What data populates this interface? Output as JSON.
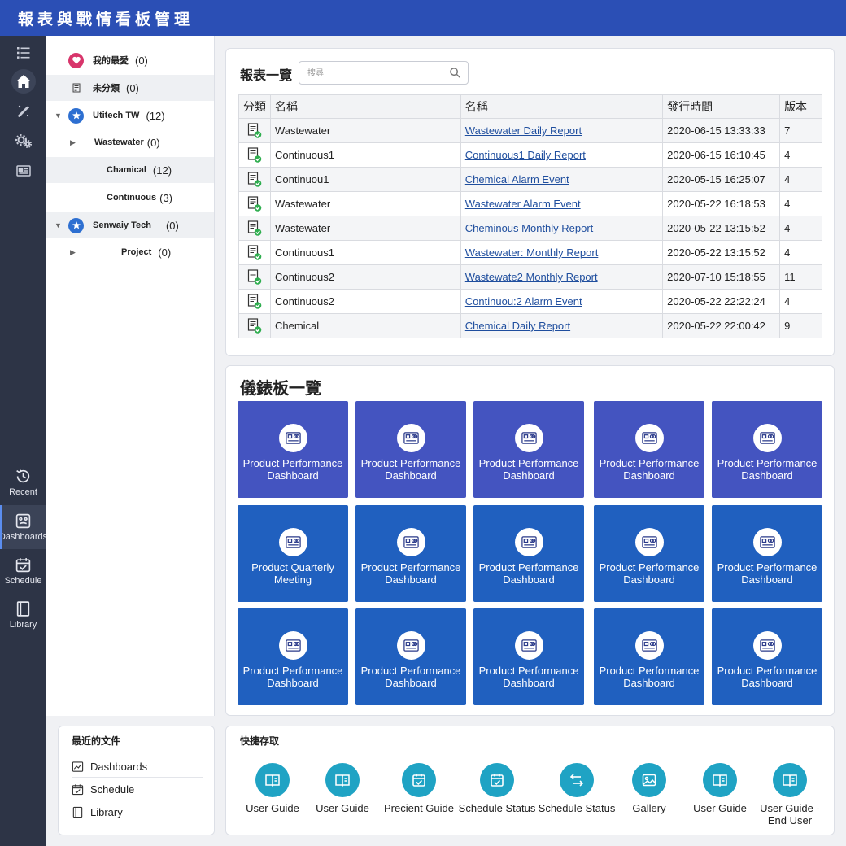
{
  "app": {
    "title": "報表與戰情看板管理"
  },
  "rail": {
    "icons": [
      {
        "name": "list-icon"
      },
      {
        "name": "home-icon"
      },
      {
        "name": "magic-wand-icon"
      },
      {
        "name": "gears-icon"
      },
      {
        "name": "id-card-icon"
      }
    ],
    "nav": [
      {
        "label": "Recent",
        "icon": "history-icon"
      },
      {
        "label": "Dashboards",
        "icon": "dashboard-icon",
        "active": true
      },
      {
        "label": "Schedule",
        "icon": "calendar-check-icon"
      },
      {
        "label": "Library",
        "icon": "book-icon"
      }
    ]
  },
  "tree": [
    {
      "label": "我的最愛",
      "count": "(0)",
      "icon": "heart-icon"
    },
    {
      "label": "未分類",
      "count": "(0)",
      "icon": "document-icon"
    },
    {
      "label": "Utitech TW",
      "count": "(12)",
      "icon": "star-icon"
    },
    {
      "label": "Wastewater",
      "count": "(0)"
    },
    {
      "label": "Chamical",
      "count": "(12)"
    },
    {
      "label": "Continuous",
      "count": "(3)"
    },
    {
      "label": "Senwaiy Tech",
      "count": "(0)",
      "icon": "star-icon"
    },
    {
      "label": "Project",
      "count": "(0)"
    }
  ],
  "recent": {
    "title": "最近的文件",
    "items": [
      {
        "label": "Dashboards",
        "icon": "chart-icon"
      },
      {
        "label": "Schedule",
        "icon": "calendar-check-icon"
      },
      {
        "label": "Library",
        "icon": "book-icon"
      }
    ]
  },
  "reports": {
    "title": "報表一覽",
    "search_placeholder": "搜尋",
    "columns": [
      "分類",
      "名稱",
      "名稱",
      "發行時間",
      "版本"
    ],
    "rows": [
      {
        "category": "Wastewater",
        "name": "Wastewater Daily Report",
        "time": "2020-06-15 13:33:33",
        "version": "7"
      },
      {
        "category": "Continuous1",
        "name": "Continuous1 Daily Report",
        "time": "2020-06-15 16:10:45",
        "version": "4"
      },
      {
        "category": "Continuou1",
        "name": "Chemical Alarm Event",
        "time": "2020-05-15 16:25:07",
        "version": "4"
      },
      {
        "category": "Wastewater",
        "name": "Wastewater Alarm Event",
        "time": "2020-05-22 16:18:53",
        "version": "4"
      },
      {
        "category": "Wastewater",
        "name": "Cheminous Monthly Report",
        "time": "2020-05-22 13:15:52",
        "version": "4"
      },
      {
        "category": "Continuous1",
        "name": "Wastewater: Monthly Report",
        "time": "2020-05-22 13:15:52",
        "version": "4"
      },
      {
        "category": "Continuous2",
        "name": "Wastewate2 Monthly Report",
        "time": "2020-07-10 15:18:55",
        "version": "11"
      },
      {
        "category": "Continuous2",
        "name": "Continuou:2 Alarm Event",
        "time": "2020-05-22 22:22:24",
        "version": "4"
      },
      {
        "category": "Chemical",
        "name": "Chemical Daily Report",
        "time": "2020-05-22 22:00:42",
        "version": "9"
      }
    ]
  },
  "dashboards": {
    "title": "儀錶板一覽",
    "rows": [
      {
        "color": "#4454c0",
        "tiles": [
          {
            "line1": "Product Performance",
            "line2": "Dashboard"
          },
          {
            "line1": "Product Performance",
            "line2": "Dashboard"
          },
          {
            "line1": "Product Performance",
            "line2": "Dashboard"
          },
          {
            "line1": "Product Performance",
            "line2": "Dashboard"
          },
          {
            "line1": "Product Performance",
            "line2": "Dashboard"
          }
        ]
      },
      {
        "color": "#2060bf",
        "tiles": [
          {
            "line1": "Product Quarterly",
            "line2": "Meeting"
          },
          {
            "line1": "Product Performance",
            "line2": "Dashboard"
          },
          {
            "line1": "Product Performance",
            "line2": "Dashboard"
          },
          {
            "line1": "Product Performance",
            "line2": "Dashboard"
          },
          {
            "line1": "Product Performance",
            "line2": "Dashboard"
          }
        ]
      },
      {
        "color": "#2060bf",
        "tiles": [
          {
            "line1": "Product Performance",
            "line2": "Dashboard"
          },
          {
            "line1": "Product Performance",
            "line2": "Dashboard"
          },
          {
            "line1": "Product Performance",
            "line2": "Dashboard"
          },
          {
            "line1": "Product Performance",
            "line2": "Dashboard"
          },
          {
            "line1": "Product Performance",
            "line2": "Dashboard"
          }
        ]
      }
    ]
  },
  "quick_access": {
    "title": "快捷存取",
    "items": [
      {
        "line1": "User Guide",
        "line2": "",
        "icon": "book-open-icon"
      },
      {
        "line1": "User Guide",
        "line2": "",
        "icon": "book-open-icon"
      },
      {
        "line1": "Precient Guide",
        "line2": "",
        "icon": "calendar-check-icon"
      },
      {
        "line1": "Schedule Status",
        "line2": "",
        "icon": "calendar-check-icon"
      },
      {
        "line1": "Schedule Status",
        "line2": "",
        "icon": "swap-arrows-icon"
      },
      {
        "line1": "Gallery",
        "line2": "",
        "icon": "image-icon"
      },
      {
        "line1": "User Guide",
        "line2": "",
        "icon": "book-open-icon"
      },
      {
        "line1": "User Guide -",
        "line2": "End User",
        "icon": "book-open-icon"
      }
    ]
  }
}
